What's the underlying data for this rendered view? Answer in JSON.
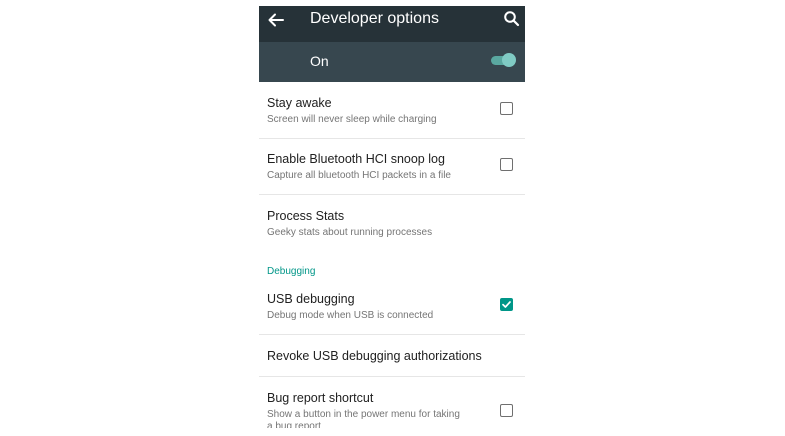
{
  "appbar": {
    "title": "Developer options",
    "back_icon": "arrow-back-icon",
    "search_icon": "search-icon",
    "color": "#263238"
  },
  "master_switch": {
    "label": "On",
    "state": "on",
    "accent": "#80cbc4"
  },
  "settings": [
    {
      "title": "Stay awake",
      "summary": "Screen will never sleep while charging",
      "control": "checkbox",
      "checked": false
    },
    {
      "title": "Enable Bluetooth HCI snoop log",
      "summary": "Capture all bluetooth HCI packets in a file",
      "control": "checkbox",
      "checked": false
    },
    {
      "title": "Process Stats",
      "summary": "Geeky stats about running processes",
      "control": "none"
    }
  ],
  "debugging": {
    "header": "Debugging",
    "items": [
      {
        "title": "USB debugging",
        "summary": "Debug mode when USB is connected",
        "control": "checkbox",
        "checked": true
      },
      {
        "title": "Revoke USB debugging authorizations",
        "control": "none"
      },
      {
        "title": "Bug report shortcut",
        "summary_line1": "Show a button in the power menu for taking",
        "summary_line2": "a bug report",
        "control": "checkbox",
        "checked": false
      }
    ]
  },
  "accent_color": "#009688"
}
